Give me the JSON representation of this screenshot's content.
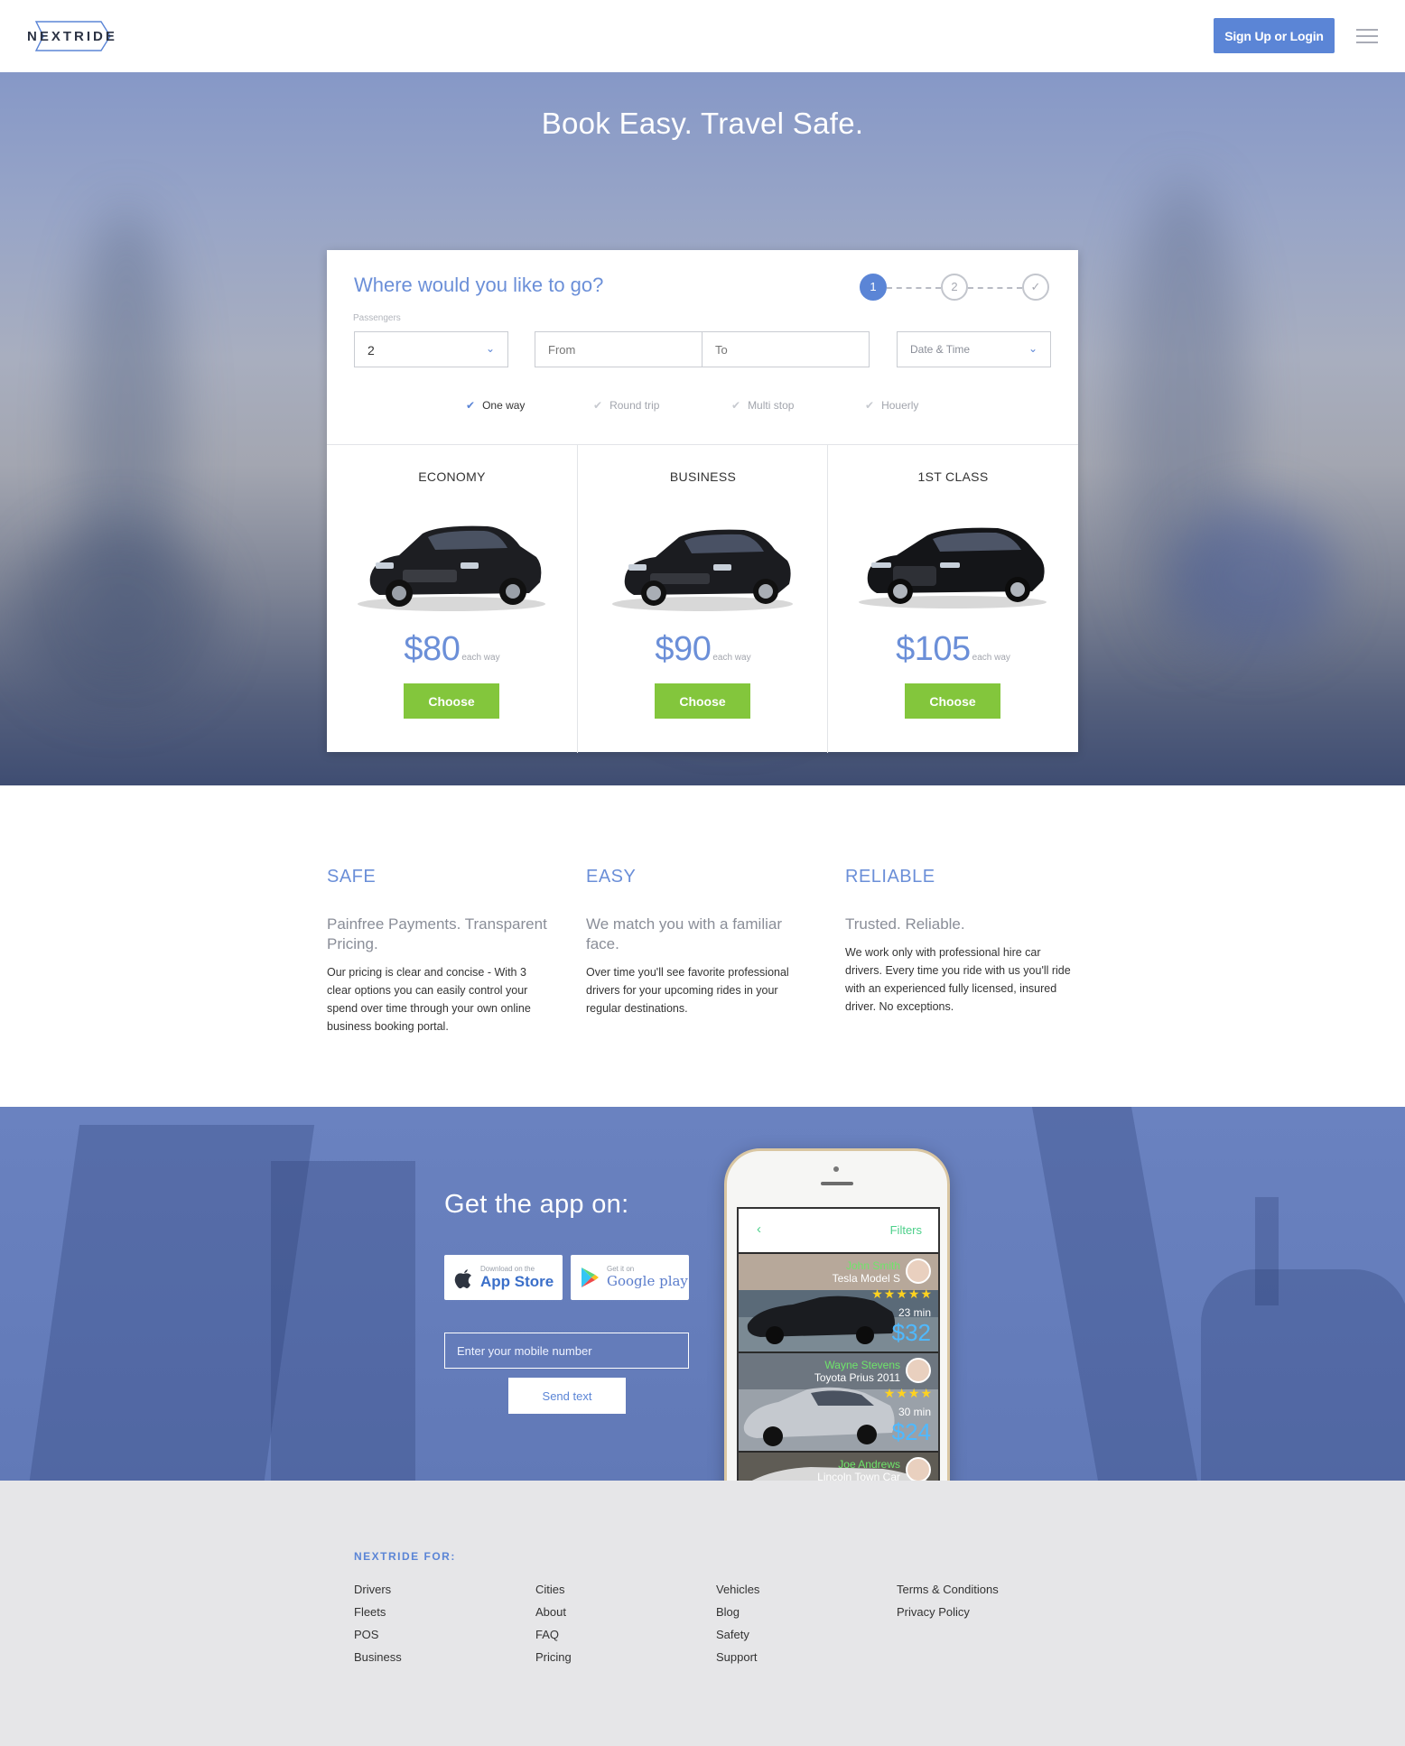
{
  "header": {
    "logo_text": "NEXTRIDE",
    "signup_label": "Sign Up or Login"
  },
  "hero": {
    "title": "Book Easy. Travel Safe."
  },
  "booking": {
    "heading": "Where would you like to go?",
    "steps": [
      "1",
      "2",
      "✓"
    ],
    "active_step": 1,
    "passengers_label": "Passengers",
    "passengers_value": "2",
    "from_placeholder": "From",
    "to_placeholder": "To",
    "datetime_placeholder": "Date & Time",
    "trip_options": [
      {
        "label": "One way",
        "selected": true
      },
      {
        "label": "Round trip",
        "selected": false
      },
      {
        "label": "Multi stop",
        "selected": false
      },
      {
        "label": "Houerly",
        "selected": false
      }
    ],
    "classes": [
      {
        "name": "ECONOMY",
        "price": "$80",
        "unit": "each way",
        "button": "Choose"
      },
      {
        "name": "BUSINESS",
        "price": "$90",
        "unit": "each way",
        "button": "Choose"
      },
      {
        "name": "1ST CLASS",
        "price": "$105",
        "unit": "each way",
        "button": "Choose"
      }
    ]
  },
  "features": [
    {
      "title": "SAFE",
      "subtitle": "Painfree Payments. Transparent Pricing.",
      "body": "Our pricing is clear and concise - With 3 clear options you can easily control your spend over time through your own online business booking portal."
    },
    {
      "title": "EASY",
      "subtitle": "We match you with a familiar face.",
      "body": "Over time you'll see favorite professional drivers for your upcoming rides in your regular destinations."
    },
    {
      "title": "RELIABLE",
      "subtitle": "Trusted. Reliable.",
      "body": "We work only with professional hire car drivers. Every time you ride with us you'll ride with an experienced fully licensed, insured driver. No exceptions."
    }
  ],
  "app": {
    "title": "Get the app on:",
    "appstore_small": "Download on the",
    "appstore_big": "App Store",
    "googleplay_small": "Get it on",
    "googleplay_big": "Google play",
    "mobile_placeholder": "Enter your mobile number",
    "send_label": "Send text",
    "phone": {
      "filters_label": "Filters",
      "rides": [
        {
          "driver": "John Smith",
          "car": "Tesla Model S",
          "stars": "★★★★★",
          "eta": "23 min",
          "fare": "$32"
        },
        {
          "driver": "Wayne Stevens",
          "car": "Toyota Prius 2011",
          "stars": "★★★★",
          "eta": "30 min",
          "fare": "$24"
        },
        {
          "driver": "Joe Andrews",
          "car": "Lincoln Town Car",
          "stars": "",
          "eta": "",
          "fare": ""
        }
      ]
    }
  },
  "footer": {
    "title": "NEXTRIDE FOR:",
    "columns": [
      [
        "Drivers",
        "Fleets",
        "POS",
        "Business"
      ],
      [
        "Cities",
        "About",
        "FAQ",
        "Pricing"
      ],
      [
        "Vehicles",
        "Blog",
        "Safety",
        "Support"
      ],
      [
        "Terms & Conditions",
        "Privacy Policy"
      ]
    ]
  },
  "colors": {
    "accent_blue": "#5b85d6",
    "heading_blue": "#6b8fd8",
    "choose_green": "#83c63c",
    "phone_green": "#4cd08a"
  }
}
